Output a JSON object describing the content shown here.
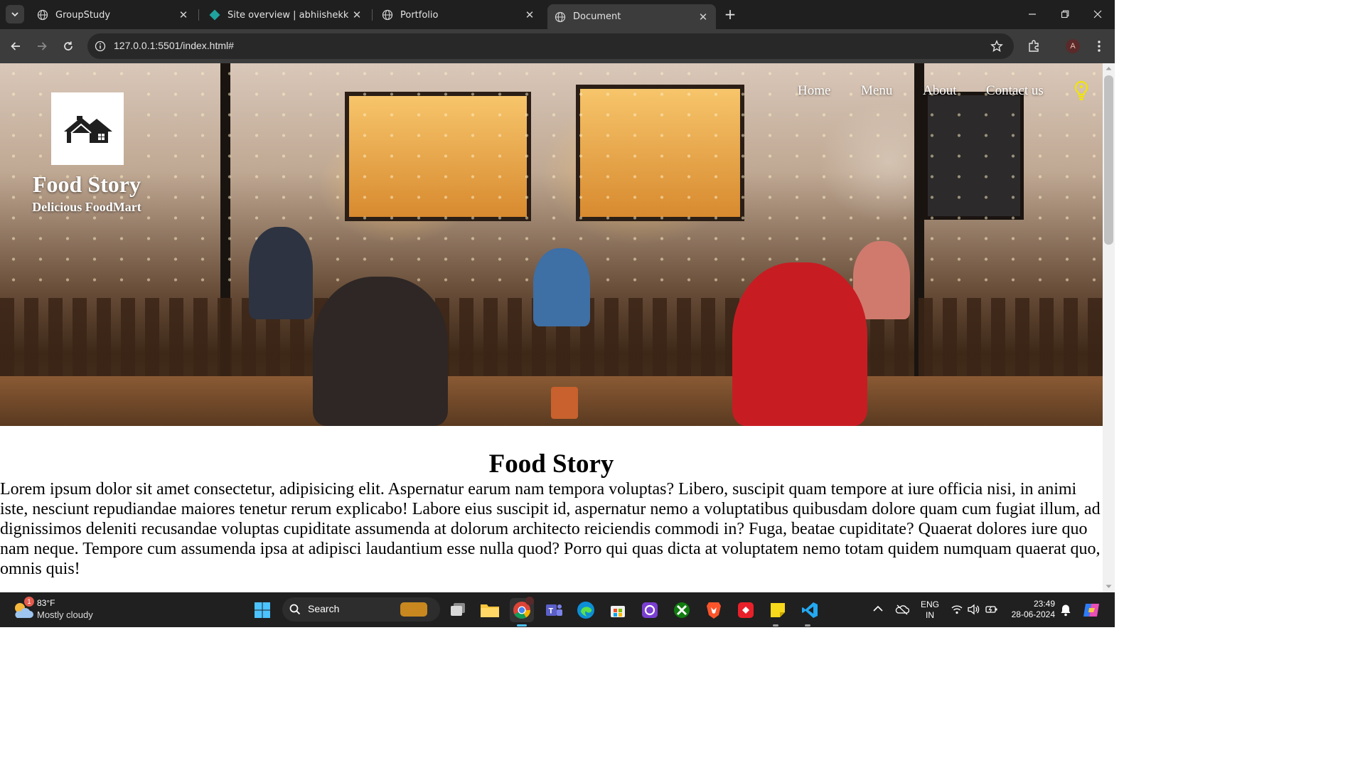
{
  "browser": {
    "tabs": [
      {
        "label": "GroupStudy",
        "icon": "globe-icon",
        "active": false
      },
      {
        "label": "Site overview | abhiishekk | Netl",
        "icon": "netlify-icon",
        "active": false
      },
      {
        "label": "Portfolio",
        "icon": "globe-icon",
        "active": false
      },
      {
        "label": "Document",
        "icon": "globe-icon",
        "active": true
      }
    ],
    "url": "127.0.0.1:5501/index.html#",
    "profile_initial": "A"
  },
  "page": {
    "brand": {
      "title": "Food Story",
      "subtitle": "Delicious FoodMart"
    },
    "nav": [
      "Home",
      "Menu",
      "About",
      "Contact us"
    ],
    "content": {
      "title": "Food Story",
      "body": "Lorem ipsum dolor sit amet consectetur, adipisicing elit. Aspernatur earum nam tempora voluptas? Libero, suscipit quam tempore at iure officia nisi, in animi iste, nesciunt repudiandae maiores tenetur rerum explicabo! Labore eius suscipit id, aspernatur nemo a voluptatibus quibusdam dolore quam cum fugiat illum, ad dignissimos deleniti recusandae voluptas cupiditate assumenda at dolorum architecto reiciendis commodi in? Fuga, beatae cupiditate? Quaerat dolores iure quo nam neque. Tempore cum assumenda ipsa at adipisci laudantium esse nulla quod? Porro qui quas dicta at voluptatem nemo totam quidem numquam quaerat quo, omnis quis!"
    }
  },
  "taskbar": {
    "weather": {
      "temp": "83°F",
      "condition": "Mostly cloudy",
      "badge": "1"
    },
    "search_placeholder": "Search",
    "apps": [
      "file-explorer-icon",
      "chrome-icon",
      "teams-icon",
      "edge-icon",
      "store-icon",
      "app-icon",
      "xbox-icon",
      "brave-icon",
      "app-icon",
      "sticky-notes-icon",
      "vscode-icon"
    ],
    "language": {
      "line1": "ENG",
      "line2": "IN"
    },
    "time": "23:49",
    "date": "28-06-2024"
  },
  "colors": {
    "tab_bar": "#1f1f1f",
    "toolbar": "#3c3c3c",
    "taskbar": "#202020",
    "hero_text": "#ffffff",
    "bulb": "#f2e500"
  }
}
